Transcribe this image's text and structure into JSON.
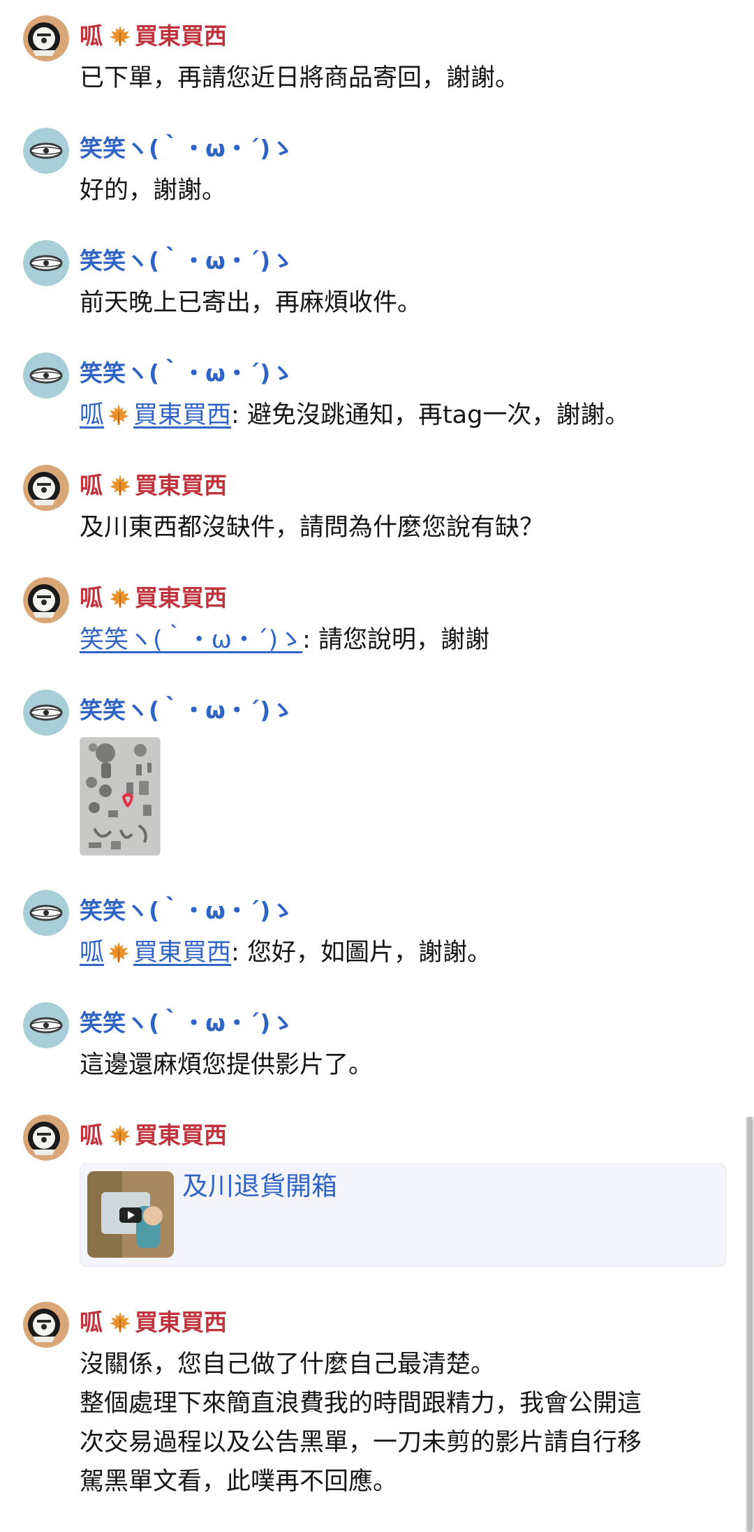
{
  "messages": [
    {
      "sender": "呱",
      "sender_suffix": "買東買西",
      "text": "已下單，再請您近日將商品寄回，謝謝。"
    },
    {
      "sender": "笑笑ヽ(｀・ω・´)ゝ",
      "text": "好的，謝謝。"
    },
    {
      "sender": "笑笑ヽ(｀・ω・´)ゝ",
      "text": "前天晚上已寄出，再麻煩收件。"
    },
    {
      "sender": "笑笑ヽ(｀・ω・´)ゝ",
      "mention_name": "呱",
      "mention_suffix": "買東買西",
      "text": ": 避免沒跳通知，再tag一次，謝謝。"
    },
    {
      "sender": "呱",
      "sender_suffix": "買東買西",
      "text": "及川東西都沒缺件，請問為什麼您說有缺？"
    },
    {
      "sender": "呱",
      "sender_suffix": "買東買西",
      "mention": "笑笑ヽ(｀・ω・´)ゝ",
      "text": ": 請您說明，謝謝"
    },
    {
      "sender": "笑笑ヽ(｀・ω・´)ゝ",
      "image_alt": "parts-photo"
    },
    {
      "sender": "笑笑ヽ(｀・ω・´)ゝ",
      "mention_name": "呱",
      "mention_suffix": "買東買西",
      "text": ": 您好，如圖片，謝謝。"
    },
    {
      "sender": "笑笑ヽ(｀・ω・´)ゝ",
      "text": "這邊還麻煩您提供影片了。"
    },
    {
      "sender": "呱",
      "sender_suffix": "買東買西",
      "card_title": "及川退貨開箱"
    },
    {
      "sender": "呱",
      "sender_suffix": "買東買西",
      "lines": [
        "沒關係，您自己做了什麼自己最清楚。",
        "整個處理下來簡直浪費我的時間跟精力，我會公開這",
        "次交易過程以及公告黑單，一刀未剪的影片請自行移",
        "駕黑單文看，此噗再不回應。"
      ]
    }
  ],
  "icons": {
    "leaf": "maple-leaf-icon",
    "play": "play-icon"
  },
  "colors": {
    "sender_red": "#c0323c",
    "sender_blue": "#2f63c4",
    "card_bg": "#f3f5fb"
  }
}
